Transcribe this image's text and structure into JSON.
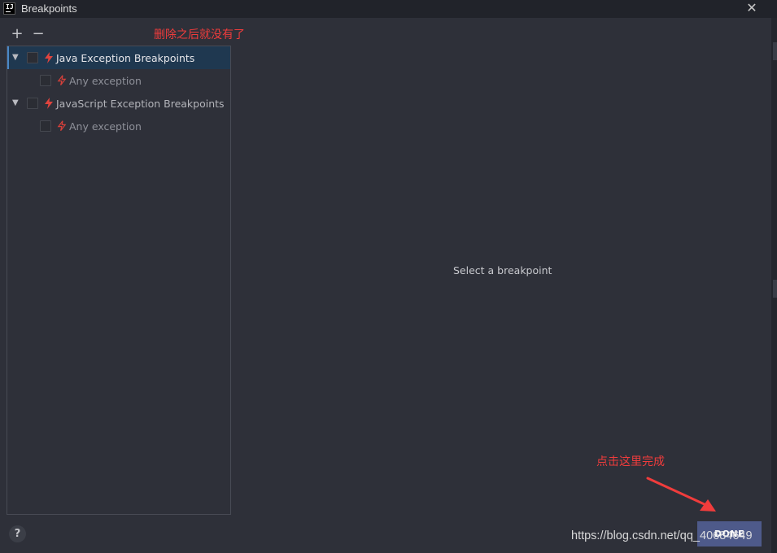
{
  "window": {
    "app_icon_text": "IJ",
    "title": "Breakpoints",
    "close_glyph": "✕"
  },
  "toolbar": {
    "add_glyph": "+",
    "remove_glyph": "−"
  },
  "annotations": {
    "top": "删除之后就没有了",
    "bottom": "点击这里完成",
    "color": "#f03c3c"
  },
  "tree": {
    "rows": [
      {
        "label": "Java Exception Breakpoints",
        "level": 0,
        "expanded": true,
        "checked": false,
        "selected": true,
        "icon": "lightning-bolt-icon"
      },
      {
        "label": "Any exception",
        "level": 1,
        "checked": false,
        "selected": false,
        "icon": "lightning-bolt-outline-icon"
      },
      {
        "label": "JavaScript Exception Breakpoints",
        "level": 0,
        "expanded": true,
        "checked": false,
        "selected": false,
        "icon": "lightning-bolt-icon"
      },
      {
        "label": "Any exception",
        "level": 1,
        "checked": false,
        "selected": false,
        "icon": "lightning-bolt-outline-icon"
      }
    ]
  },
  "details": {
    "empty_message": "Select a breakpoint"
  },
  "footer": {
    "help_glyph": "?",
    "done_label": "DONE",
    "watermark": "https://blog.csdn.net/qq_40684649"
  },
  "colors": {
    "accent": "#4a88c7",
    "bolt": "#e0443e",
    "done_button": "#4e5a8a",
    "background": "#2e3039"
  }
}
